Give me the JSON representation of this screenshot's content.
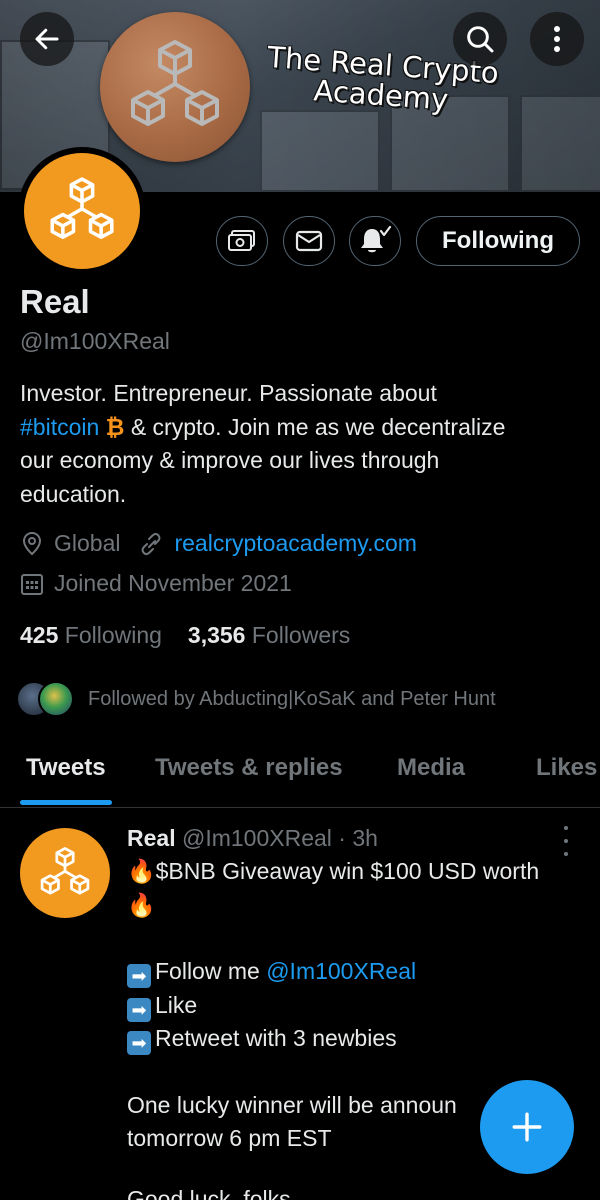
{
  "banner": {
    "title_line1": "The Real Crypto",
    "title_line2": "Academy"
  },
  "actions": {
    "follow_state": "Following"
  },
  "profile": {
    "name": "Real",
    "handle": "@Im100XReal",
    "bio": {
      "line1": "Investor. Entrepreneur. Passionate about",
      "hashtag": "#bitcoin",
      "btc_symbol": "₿",
      "line2_rest": " & crypto. Join me as we decentralize",
      "line3": "our economy & improve our lives through",
      "line4": "education."
    },
    "location": "Global",
    "website": "realcryptoacademy.com",
    "joined": "Joined November 2021",
    "following_count": "425",
    "following_label": "Following",
    "followers_count": "3,356",
    "followers_label": "Followers",
    "followed_by": "Followed by Abducting|KoSaK and Peter Hunt"
  },
  "tabs": [
    {
      "label": "Tweets",
      "active": true
    },
    {
      "label": "Tweets & replies",
      "active": false
    },
    {
      "label": "Media",
      "active": false
    },
    {
      "label": "Likes",
      "active": false
    }
  ],
  "tweet": {
    "author": "Real",
    "handle": "@Im100XReal",
    "separator": "·",
    "time": "3h",
    "line1": "$BNB Giveaway win $100 USD worth",
    "line3a": "Follow me ",
    "line3_mention": "@Im100XReal",
    "line4": "Like",
    "line5": "Retweet with 3 newbies",
    "line6": "One lucky winner will be announ",
    "line7": "tomorrow 6 pm EST",
    "line8": "Good luck, folks"
  },
  "icons": {
    "back": "arrow-left-icon",
    "search": "search-icon",
    "more": "more-vertical-icon",
    "tip": "money-icon",
    "message": "mail-icon",
    "notify": "bell-check-icon",
    "location": "location-pin-icon",
    "website": "link-icon",
    "calendar": "calendar-icon",
    "compose": "plus-icon"
  },
  "colors": {
    "accent": "#1d9bf0",
    "avatar_orange": "#f29a1f",
    "muted": "#71767b",
    "background": "#000000"
  }
}
